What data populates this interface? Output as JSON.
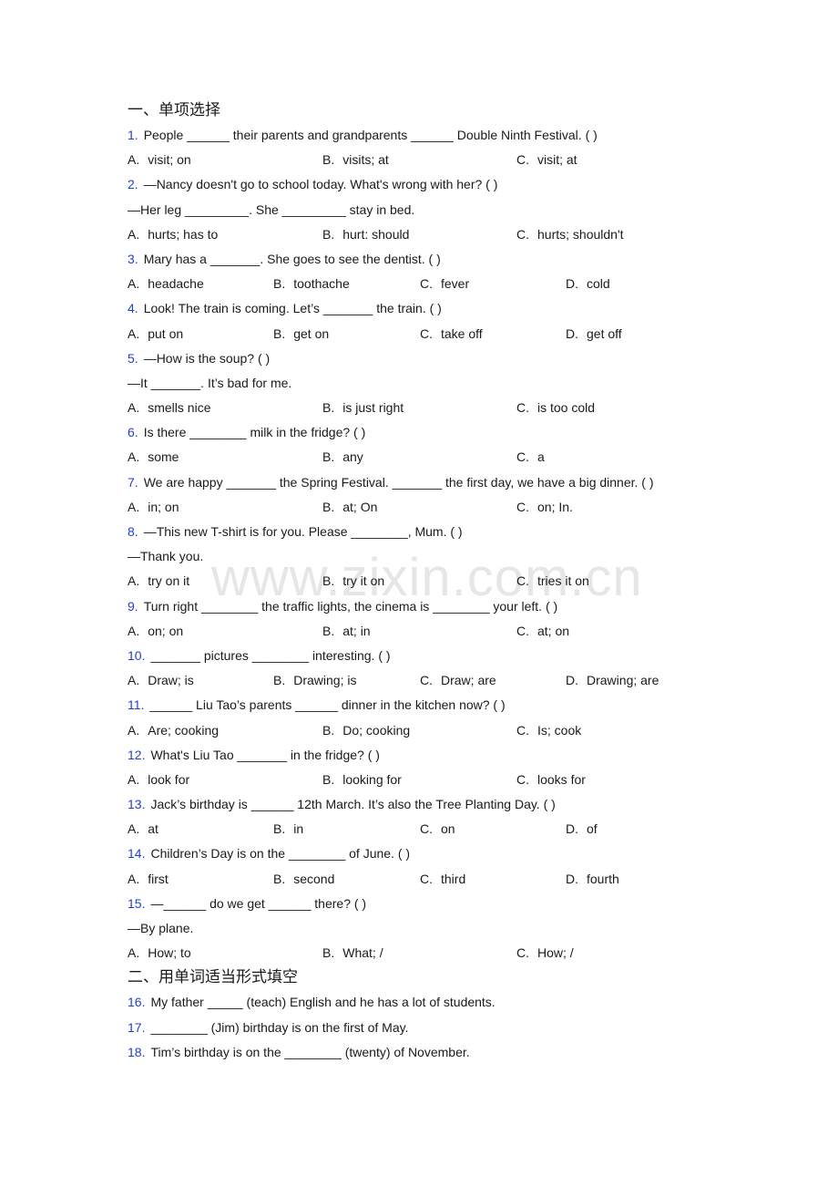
{
  "watermark": "www.zixin.com.cn",
  "sections": [
    {
      "title": "一、单项选择",
      "questions": [
        {
          "num": "1.",
          "lines": [
            "People ______ their parents and grandparents ______ Double Ninth Festival. (    )"
          ],
          "options": [
            {
              "letter": "A.",
              "text": "visit; on"
            },
            {
              "letter": "B.",
              "text": "visits; at"
            },
            {
              "letter": "C.",
              "text": "visit; at"
            }
          ]
        },
        {
          "num": "2.",
          "lines": [
            "—Nancy doesn't go to school today. What's wrong with her? (    )",
            "—Her leg _________. She _________ stay in bed."
          ],
          "options": [
            {
              "letter": "A.",
              "text": "hurts; has to"
            },
            {
              "letter": "B.",
              "text": "hurt: should"
            },
            {
              "letter": "C.",
              "text": "hurts; shouldn't"
            }
          ]
        },
        {
          "num": "3.",
          "lines": [
            "Mary has a _______. She goes to see the dentist. (   )"
          ],
          "options": [
            {
              "letter": "A.",
              "text": "headache"
            },
            {
              "letter": "B.",
              "text": "toothache"
            },
            {
              "letter": "C.",
              "text": "fever"
            },
            {
              "letter": "D.",
              "text": "cold"
            }
          ]
        },
        {
          "num": "4.",
          "lines": [
            "Look! The train is coming. Let’s _______ the train. (   )"
          ],
          "options": [
            {
              "letter": "A.",
              "text": "put on"
            },
            {
              "letter": "B.",
              "text": "get on"
            },
            {
              "letter": "C.",
              "text": "take off"
            },
            {
              "letter": "D.",
              "text": "get off"
            }
          ]
        },
        {
          "num": "5.",
          "lines": [
            "—How is the soup? (   )",
            "—It _______. It’s bad for me."
          ],
          "options": [
            {
              "letter": "A.",
              "text": "smells nice"
            },
            {
              "letter": "B.",
              "text": "is just right"
            },
            {
              "letter": "C.",
              "text": "is too cold"
            }
          ]
        },
        {
          "num": "6.",
          "lines": [
            "Is there ________ milk in the fridge? (     )"
          ],
          "options": [
            {
              "letter": "A.",
              "text": "some"
            },
            {
              "letter": "B.",
              "text": "any"
            },
            {
              "letter": "C.",
              "text": "a"
            }
          ]
        },
        {
          "num": "7.",
          "lines": [
            "We are happy _______ the Spring Festival. _______ the first day, we have a big dinner. (     )"
          ],
          "options": [
            {
              "letter": "A.",
              "text": "in; on"
            },
            {
              "letter": "B.",
              "text": "at; On"
            },
            {
              "letter": "C.",
              "text": "on; In."
            }
          ]
        },
        {
          "num": "8.",
          "lines": [
            "—This new T-shirt is for you. Please ________, Mum. (      )",
            "—Thank you."
          ],
          "options": [
            {
              "letter": "A.",
              "text": "try on it"
            },
            {
              "letter": "B.",
              "text": "try it on"
            },
            {
              "letter": "C.",
              "text": "tries it on"
            }
          ]
        },
        {
          "num": "9.",
          "lines": [
            "Turn right ________ the traffic lights, the cinema is ________ your left. (   )"
          ],
          "options": [
            {
              "letter": "A.",
              "text": "on; on"
            },
            {
              "letter": "B.",
              "text": "at; in"
            },
            {
              "letter": "C.",
              "text": "at; on"
            }
          ]
        },
        {
          "num": "10.",
          "lines": [
            "_______ pictures ________ interesting. (   )"
          ],
          "options": [
            {
              "letter": "A.",
              "text": "Draw; is"
            },
            {
              "letter": "B.",
              "text": "Drawing; is"
            },
            {
              "letter": "C.",
              "text": "Draw; are"
            },
            {
              "letter": "D.",
              "text": "Drawing; are"
            }
          ]
        },
        {
          "num": "11.",
          "lines": [
            "______ Liu Tao’s parents ______ dinner in the kitchen now? (    )"
          ],
          "options": [
            {
              "letter": "A.",
              "text": "Are; cooking"
            },
            {
              "letter": "B.",
              "text": "Do; cooking"
            },
            {
              "letter": "C.",
              "text": "Is; cook"
            }
          ]
        },
        {
          "num": "12.",
          "lines": [
            "What's Liu Tao _______ in the fridge? (   )"
          ],
          "options": [
            {
              "letter": "A.",
              "text": "look for"
            },
            {
              "letter": "B.",
              "text": "looking for"
            },
            {
              "letter": "C.",
              "text": "looks for"
            }
          ]
        },
        {
          "num": "13.",
          "lines": [
            "Jack’s birthday is ______ 12th March. It’s also the Tree Planting Day. (     )"
          ],
          "options": [
            {
              "letter": "A.",
              "text": "at"
            },
            {
              "letter": "B.",
              "text": "in"
            },
            {
              "letter": "C.",
              "text": "on"
            },
            {
              "letter": "D.",
              "text": "of"
            }
          ]
        },
        {
          "num": "14.",
          "lines": [
            "Children’s Day is on the ________ of June. (   )"
          ],
          "options": [
            {
              "letter": "A.",
              "text": "first"
            },
            {
              "letter": "B.",
              "text": "second"
            },
            {
              "letter": "C.",
              "text": "third"
            },
            {
              "letter": "D.",
              "text": "fourth"
            }
          ]
        },
        {
          "num": "15.",
          "lines": [
            "—______ do we get ______ there? (    )",
            "—By plane."
          ],
          "options": [
            {
              "letter": "A.",
              "text": "How; to"
            },
            {
              "letter": "B.",
              "text": "What; /"
            },
            {
              "letter": "C.",
              "text": "How; /"
            }
          ]
        }
      ]
    },
    {
      "title": "二、用单词适当形式填空",
      "questions": [
        {
          "num": "16.",
          "lines": [
            "My father _____ (teach) English and he has a lot of students."
          ],
          "options": []
        },
        {
          "num": "17.",
          "lines": [
            "________ (Jim) birthday is on the first of May."
          ],
          "options": []
        },
        {
          "num": "18.",
          "lines": [
            "Tim’s birthday is on the ________ (twenty) of November."
          ],
          "options": []
        }
      ]
    }
  ]
}
